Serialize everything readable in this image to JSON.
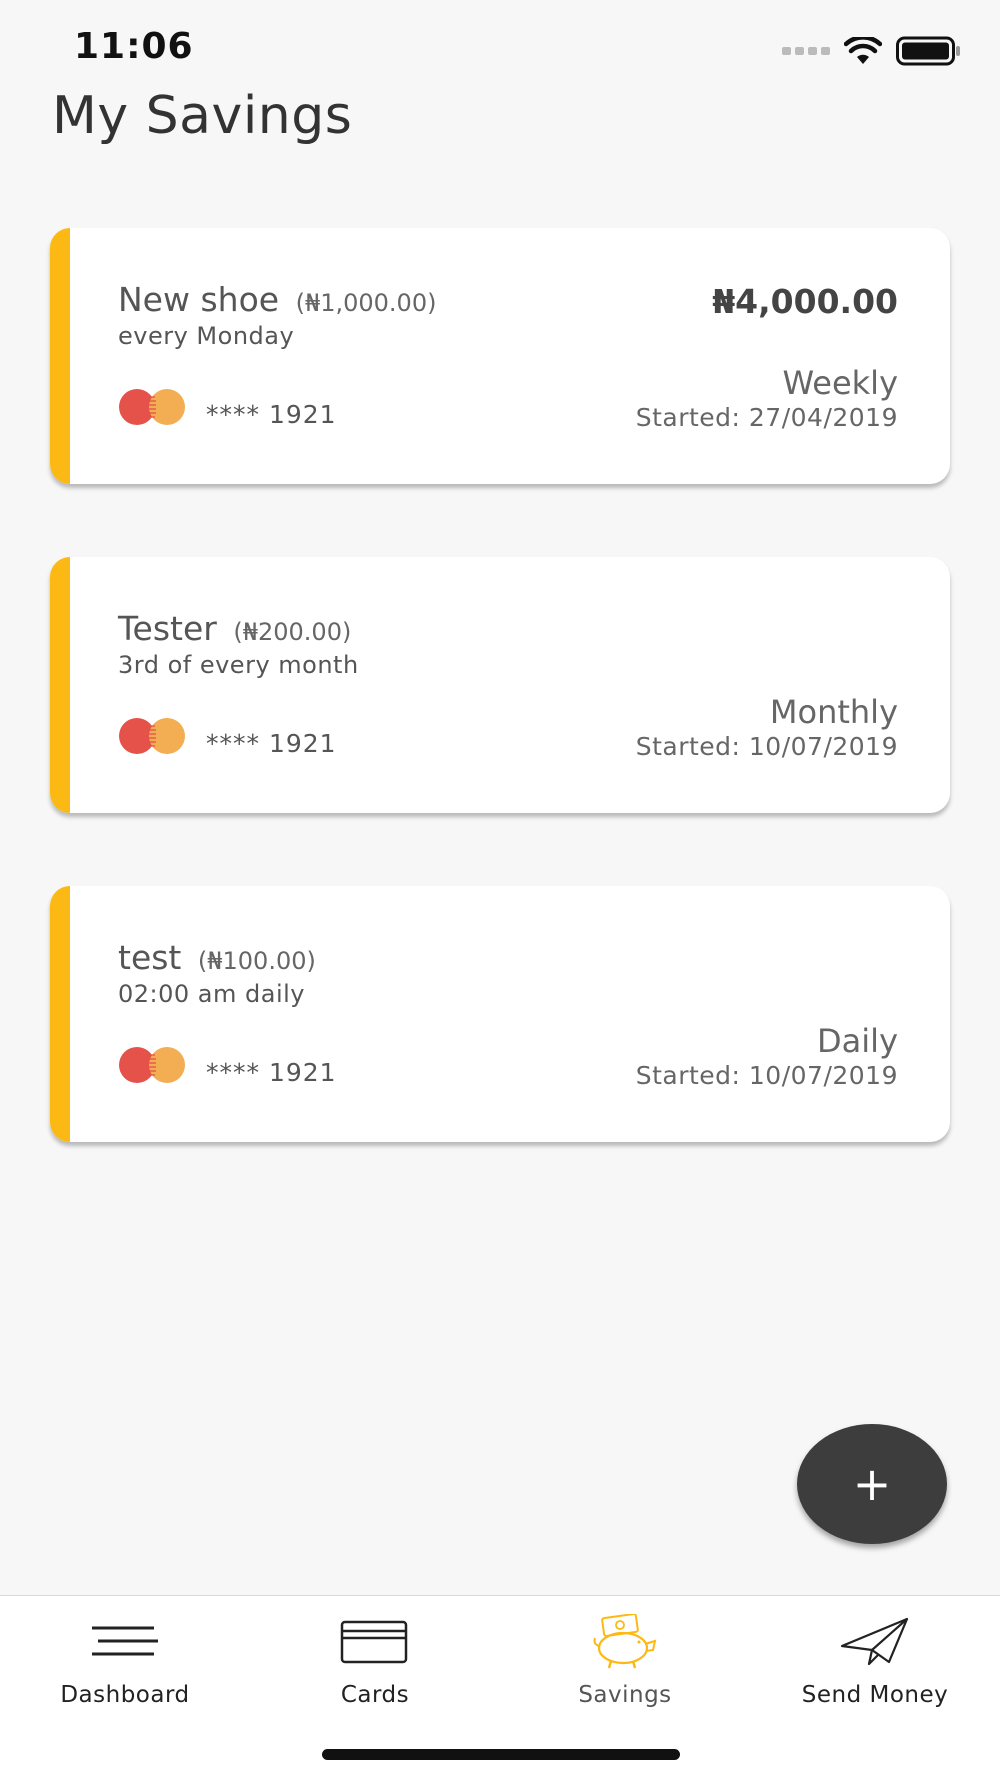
{
  "status_bar": {
    "time": "11:06"
  },
  "page": {
    "title": "My Savings"
  },
  "savings": [
    {
      "name": "New shoe",
      "amount": "(₦1,000.00)",
      "schedule": "every Monday",
      "total": "₦4,000.00",
      "card_number": "**** 1921",
      "frequency": "Weekly",
      "started": "Started: 27/04/2019"
    },
    {
      "name": "Tester",
      "amount": "(₦200.00)",
      "schedule": "3rd of every month",
      "total": "",
      "card_number": "**** 1921",
      "frequency": "Monthly",
      "started": "Started: 10/07/2019"
    },
    {
      "name": "test",
      "amount": "(₦100.00)",
      "schedule": "02:00 am daily",
      "total": "",
      "card_number": "**** 1921",
      "frequency": "Daily",
      "started": "Started: 10/07/2019"
    }
  ],
  "fab": {
    "label": "+"
  },
  "nav": {
    "items": [
      {
        "label": "Dashboard",
        "icon": "menu-icon"
      },
      {
        "label": "Cards",
        "icon": "card-icon"
      },
      {
        "label": "Savings",
        "icon": "piggy-bank-icon",
        "active": true
      },
      {
        "label": "Send Money",
        "icon": "paper-plane-icon"
      }
    ]
  },
  "colors": {
    "accent": "#fdb913",
    "fab": "#3d3d3d",
    "background": "#f7f7f7",
    "mastercard_red": "#e4524a",
    "mastercard_orange": "#f3ad52"
  }
}
